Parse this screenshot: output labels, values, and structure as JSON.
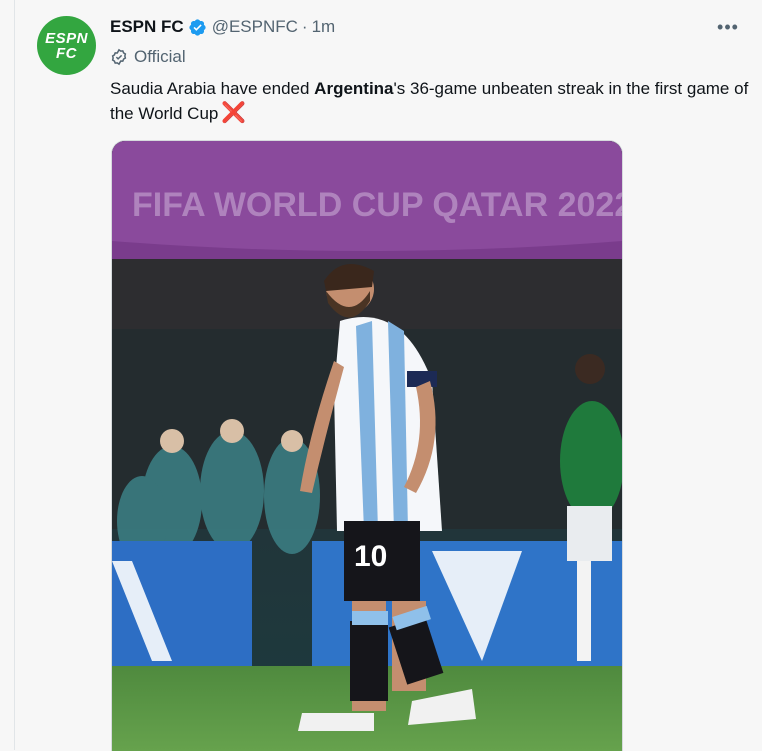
{
  "tweet": {
    "author_name": "ESPN FC",
    "handle": "@ESPNFC",
    "separator": "·",
    "time": "1m",
    "label": "Official",
    "text_before": "Saudia Arabia have ended ",
    "text_bold": "Argentina",
    "text_after": "'s 36-game unbeaten streak in the first game of the World Cup",
    "cross_emoji": "❌",
    "more_label": "•••"
  },
  "avatar": {
    "line1": "ESPN",
    "line2": "FC",
    "color": "#33a640"
  },
  "colors": {
    "verified": "#1d9bf0",
    "cross": "#dd2e44",
    "secondary_text": "#536471"
  },
  "icons": {
    "verified": "verified-badge-icon",
    "official": "official-label-icon",
    "more": "more-options-icon"
  },
  "media": {
    "banner_text": "FIFA WORLD CUP QATAR 2022",
    "player_number": "10"
  }
}
